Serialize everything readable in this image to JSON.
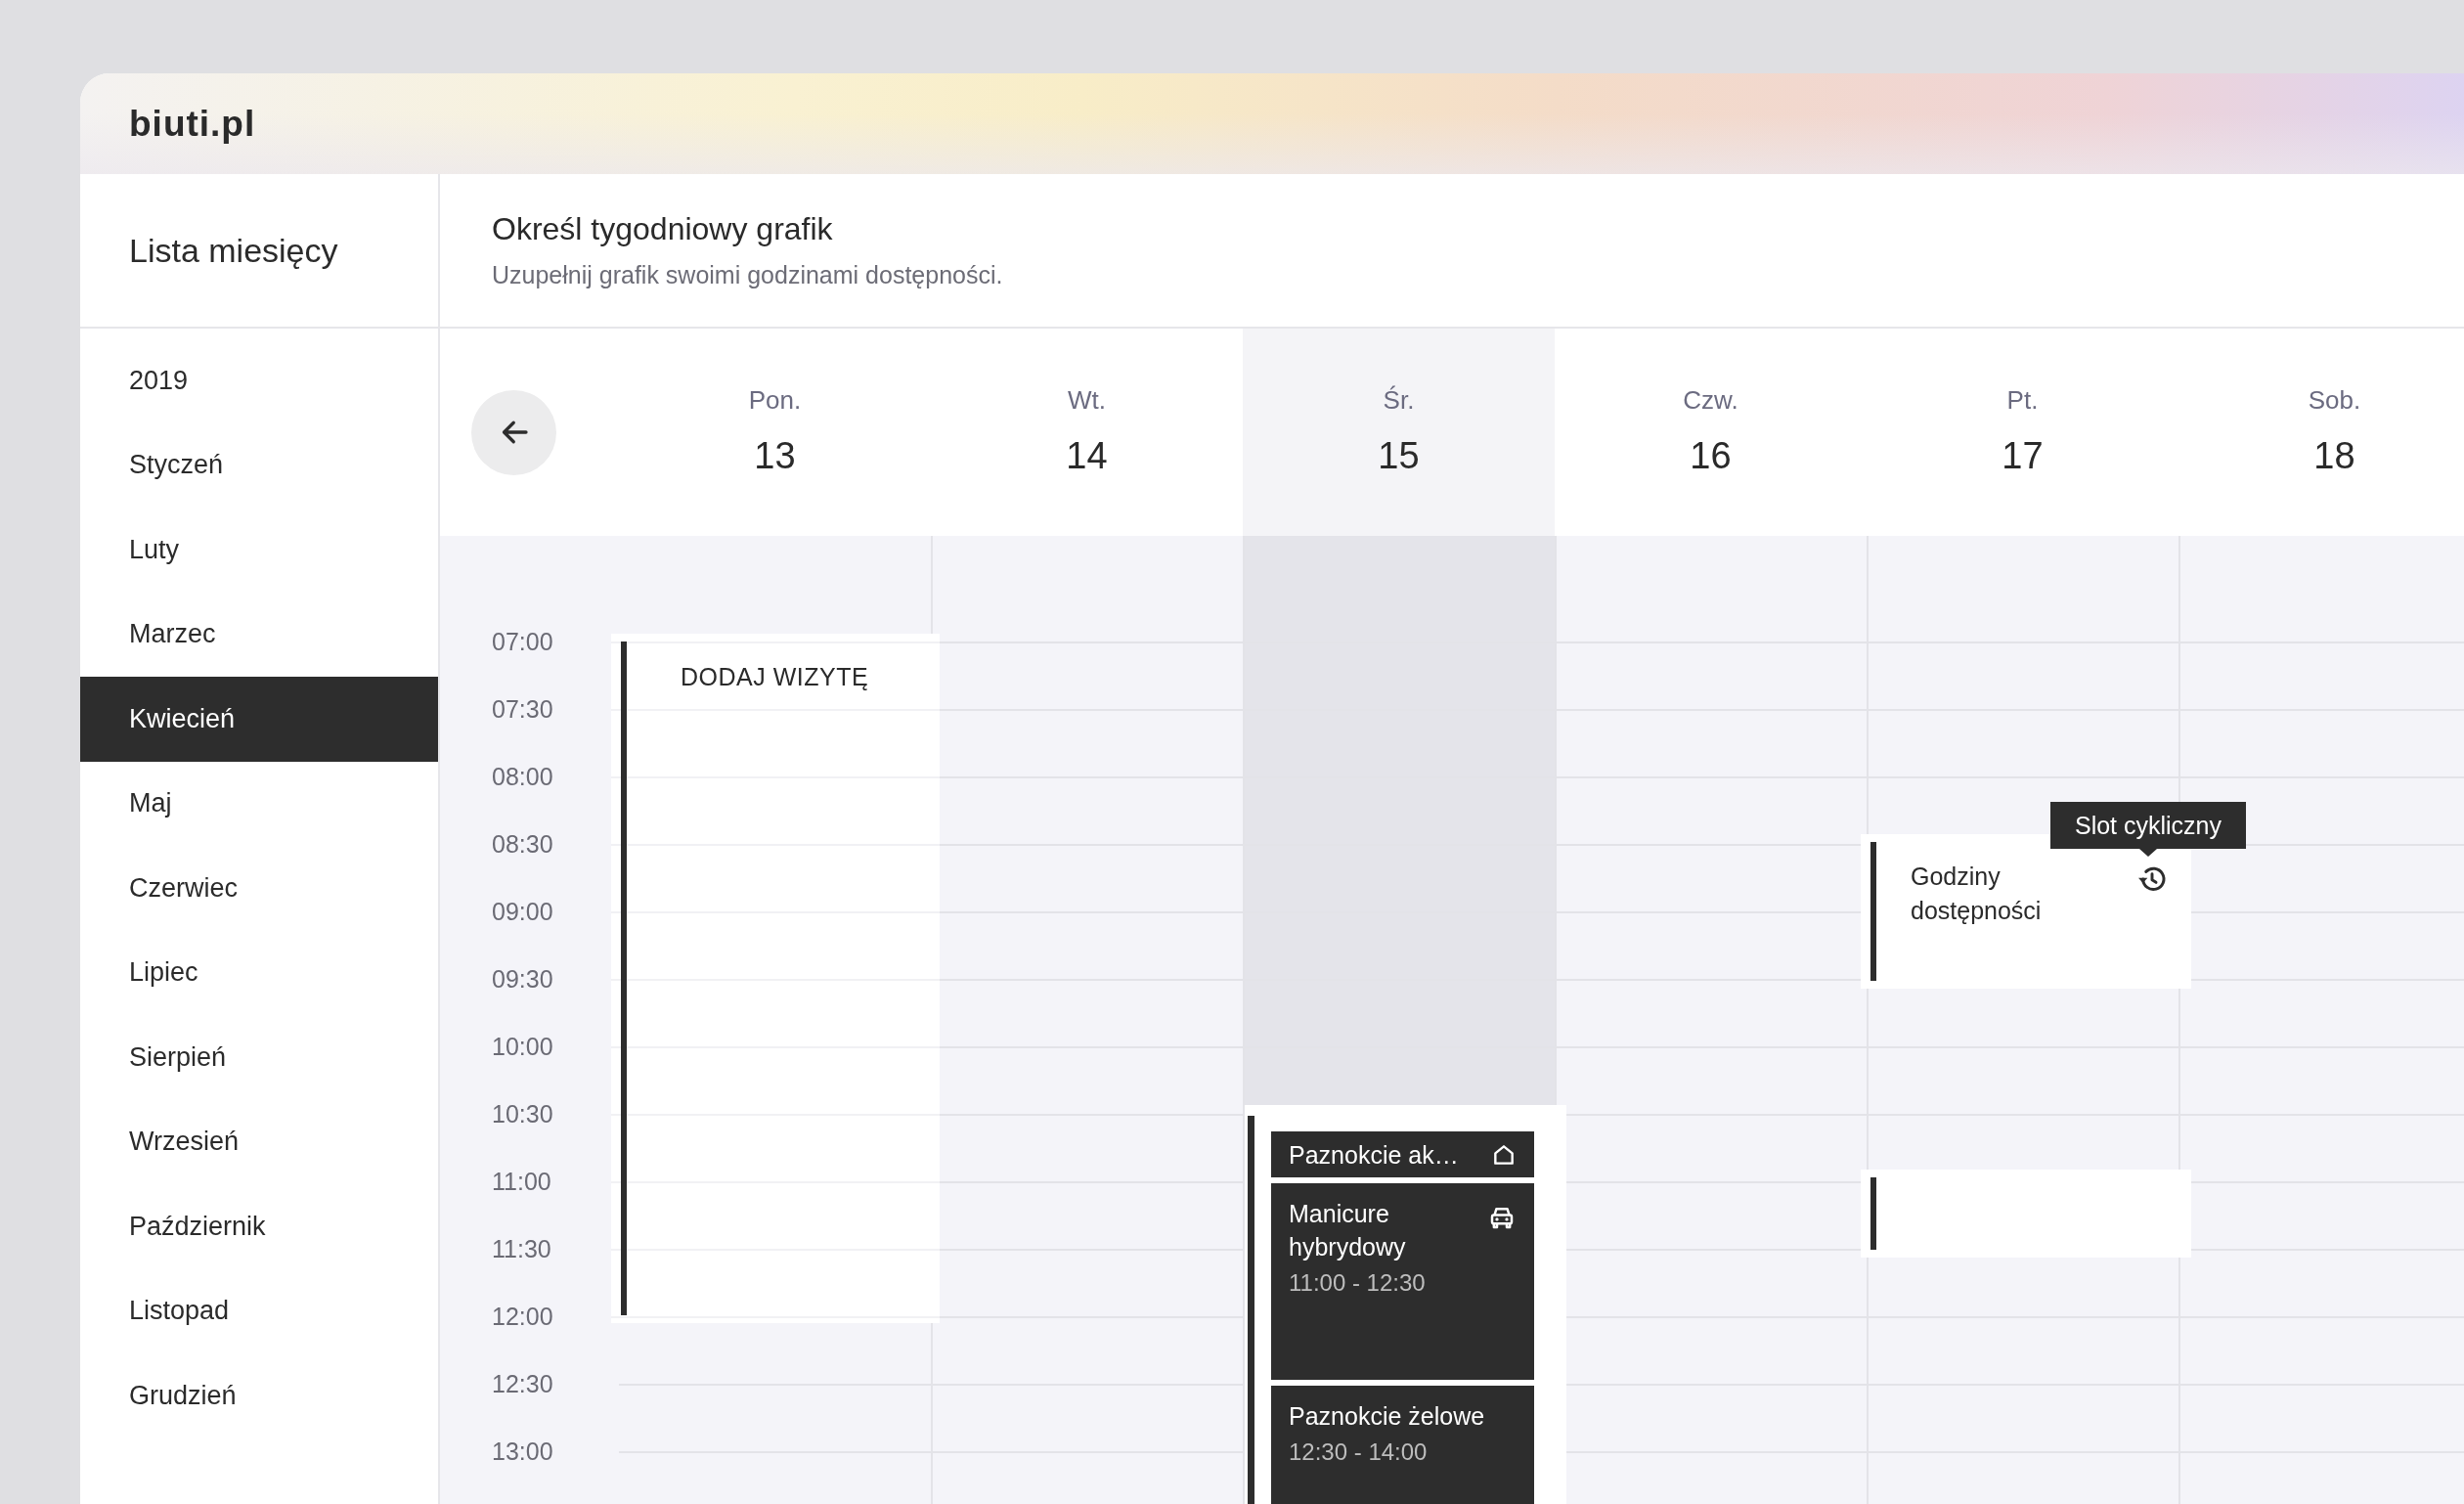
{
  "app": {
    "logo": "biuti.pl"
  },
  "sidebar": {
    "title": "Lista miesięcy",
    "year": "2019",
    "items": [
      {
        "label": "Styczeń",
        "selected": false
      },
      {
        "label": "Luty",
        "selected": false
      },
      {
        "label": "Marzec",
        "selected": false
      },
      {
        "label": "Kwiecień",
        "selected": true
      },
      {
        "label": "Maj",
        "selected": false
      },
      {
        "label": "Czerwiec",
        "selected": false
      },
      {
        "label": "Lipiec",
        "selected": false
      },
      {
        "label": "Sierpień",
        "selected": false
      },
      {
        "label": "Wrzesień",
        "selected": false
      },
      {
        "label": "Październik",
        "selected": false
      },
      {
        "label": "Listopad",
        "selected": false
      },
      {
        "label": "Grudzień",
        "selected": false
      }
    ]
  },
  "header": {
    "title": "Określ tygodniowy grafik",
    "subtitle": "Uzupełnij grafik swoimi godzinami dostępności."
  },
  "time_slots": [
    "07:00",
    "07:30",
    "08:00",
    "08:30",
    "09:00",
    "09:30",
    "10:00",
    "10:30",
    "11:00",
    "11:30",
    "12:00",
    "12:30",
    "13:00"
  ],
  "days": [
    {
      "label": "Pon.",
      "date": "13",
      "selected": false,
      "events": [
        {
          "kind": "add",
          "label": "DODAJ WIZYTĘ"
        }
      ]
    },
    {
      "label": "Wt.",
      "date": "14",
      "selected": false
    },
    {
      "label": "Śr.",
      "date": "15",
      "selected": true,
      "events": [
        {
          "kind": "appointments",
          "items": [
            {
              "title": "Paznokcie ak…"
            },
            {
              "title": "Manicure hybrydowy",
              "time": "11:00 - 12:30"
            },
            {
              "title": "Paznokcie żelowe",
              "time": "12:30 - 14:00"
            }
          ]
        }
      ]
    },
    {
      "label": "Czw.",
      "date": "16",
      "selected": false
    },
    {
      "label": "Pt.",
      "date": "17",
      "selected": false,
      "events": [
        {
          "kind": "availability",
          "title": "Godziny dostępności",
          "tooltip": "Slot cykliczny"
        },
        {
          "kind": "availability"
        }
      ]
    },
    {
      "label": "Sob.",
      "date": "18",
      "selected": false
    }
  ]
}
